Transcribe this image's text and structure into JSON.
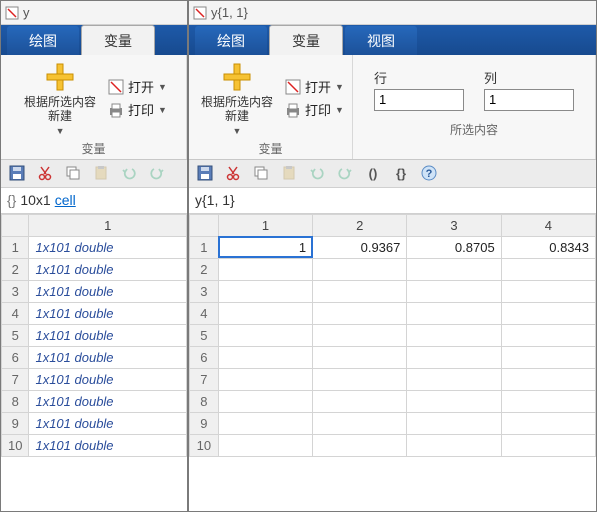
{
  "left_window": {
    "title": "y",
    "tabs": {
      "plot": "绘图",
      "variable": "变量"
    },
    "ribbon": {
      "new_label": "根据所选内容\n新建",
      "open_label": "打开",
      "print_label": "打印",
      "group_caption": "变量"
    },
    "info": {
      "size": "10x1",
      "type": "cell"
    },
    "col_header": "1",
    "rows": [
      "1",
      "2",
      "3",
      "4",
      "5",
      "6",
      "7",
      "8",
      "9",
      "10"
    ],
    "cell_text": "1x101 double"
  },
  "right_window": {
    "title": "y{1, 1}",
    "tabs": {
      "plot": "绘图",
      "variable": "变量",
      "view": "视图"
    },
    "ribbon": {
      "new_label": "根据所选内容\n新建",
      "open_label": "打开",
      "print_label": "打印",
      "group1_caption": "变量",
      "row_label": "行",
      "col_label": "列",
      "row_value": "1",
      "col_value": "1",
      "group2_caption": "所选内容"
    },
    "info": {
      "expr": "y{1, 1}"
    },
    "col_headers": [
      "1",
      "2",
      "3",
      "4"
    ],
    "row_headers": [
      "1",
      "2",
      "3",
      "4",
      "5",
      "6",
      "7",
      "8",
      "9",
      "10"
    ],
    "data_row1": [
      "1",
      "0.9367",
      "0.8705",
      "0.8343"
    ]
  }
}
